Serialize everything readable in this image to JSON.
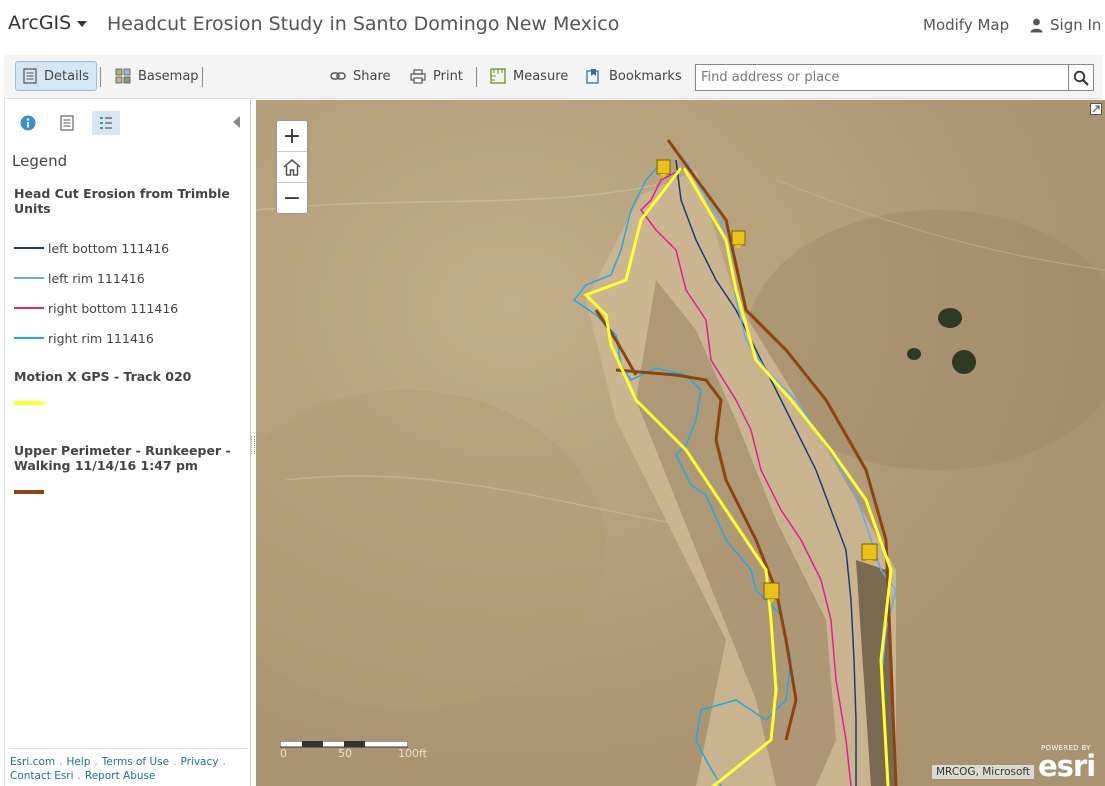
{
  "header": {
    "brand": "ArcGIS",
    "title": "Headcut Erosion Study in Santo Domingo New Mexico",
    "modify_map": "Modify Map",
    "sign_in": "Sign In"
  },
  "toolbar": {
    "details": "Details",
    "basemap": "Basemap",
    "share": "Share",
    "print": "Print",
    "measure": "Measure",
    "bookmarks": "Bookmarks",
    "search_placeholder": "Find address or place"
  },
  "panel": {
    "legend_heading": "Legend",
    "layers": [
      {
        "title": "Head Cut Erosion from Trimble Units",
        "items": [
          {
            "label": "left bottom 111416",
            "color": "#1f3a73"
          },
          {
            "label": "left rim 111416",
            "color": "#6aa8e6"
          },
          {
            "label": "right bottom 111416",
            "color": "#d6268d"
          },
          {
            "label": "right rim 111416",
            "color": "#2aa6dd"
          }
        ]
      },
      {
        "title": "Motion X GPS - Track 020",
        "color": "#ffff33"
      },
      {
        "title": "Upper Perimeter - Runkeeper - Walking 11/14/16 1:47 pm",
        "color": "#8b4513"
      }
    ],
    "footer": {
      "esri": "Esri.com",
      "help": "Help",
      "terms": "Terms of Use",
      "privacy": "Privacy",
      "contact": "Contact Esri",
      "abuse": "Report Abuse"
    }
  },
  "map": {
    "zoom_in": "+",
    "zoom_out": "−",
    "scale_labels": [
      "0",
      "50",
      "100ft"
    ],
    "attribution": "MRCOG, Microsoft",
    "esri_powered": "POWERED BY",
    "esri_logo": "esri"
  },
  "icons": {
    "details": "details-doc-icon",
    "basemap": "basemap-grid-icon",
    "share": "link-icon",
    "print": "printer-icon",
    "measure": "ruler-icon",
    "bookmarks": "bookmark-icon",
    "search": "magnifier-icon",
    "user": "person-icon",
    "home": "home-icon"
  }
}
